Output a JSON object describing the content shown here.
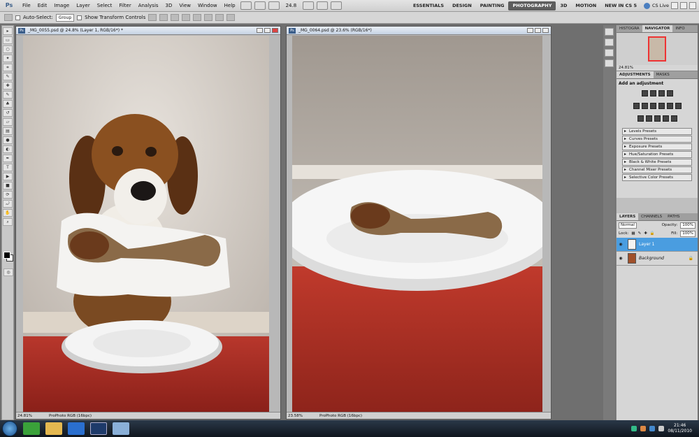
{
  "app": {
    "logo": "Ps"
  },
  "menu": [
    "File",
    "Edit",
    "Image",
    "Layer",
    "Select",
    "Filter",
    "Analysis",
    "3D",
    "View",
    "Window",
    "Help"
  ],
  "menubar": {
    "zoom": "24.8",
    "workspaces": [
      "ESSENTIALS",
      "DESIGN",
      "PAINTING",
      "PHOTOGRAPHY",
      "3D",
      "MOTION",
      "NEW IN CS 5"
    ],
    "active_workspace": "PHOTOGRAPHY",
    "cs_live": "CS Live"
  },
  "options": {
    "auto_select": "Auto-Select:",
    "auto_select_value": "Group",
    "show_transform": "Show Transform Controls"
  },
  "doc1": {
    "title": "_MG_0055.psd @ 24.8% (Layer 1, RGB/16*) *",
    "zoom": "24.81%",
    "profile": "ProPhoto RGB (16bpc)"
  },
  "doc2": {
    "title": "_MG_0064.psd @ 23.6% (RGB/16*)",
    "zoom": "23.58%",
    "profile": "ProPhoto RGB (16bpc)"
  },
  "panels": {
    "nav_tabs": [
      "HISTOGRA",
      "NAVIGATOR",
      "INFO"
    ],
    "nav_zoom": "24.81%",
    "adj_tabs": [
      "ADJUSTMENTS",
      "MASKS"
    ],
    "adj_title": "Add an adjustment",
    "presets": [
      "Levels Presets",
      "Curves Presets",
      "Exposure Presets",
      "Hue/Saturation Presets",
      "Black & White Presets",
      "Channel Mixer Presets",
      "Selective Color Presets"
    ],
    "layers_tabs": [
      "LAYERS",
      "CHANNELS",
      "PATHS"
    ],
    "blend_mode": "Normal",
    "opacity_label": "Opacity:",
    "opacity": "100%",
    "lock_label": "Lock:",
    "fill_label": "Fill:",
    "fill": "100%",
    "layers": [
      {
        "name": "Layer 1"
      },
      {
        "name": "Background"
      }
    ]
  },
  "taskbar": {
    "time": "21:46",
    "date": "08/11/2010"
  }
}
